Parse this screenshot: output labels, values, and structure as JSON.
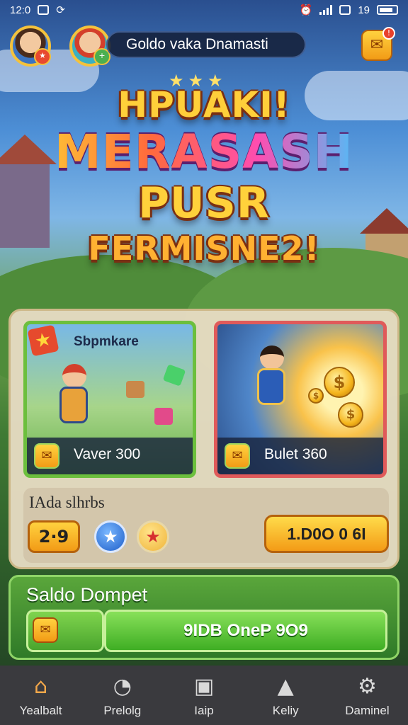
{
  "status_bar": {
    "time": "12:0",
    "battery": "19"
  },
  "header": {
    "player_name": "Goldo vaka Dnamasti"
  },
  "title": {
    "line1": "HPUAKI!",
    "line2": "MERASASH",
    "line3": "PUSR",
    "line4": "FERMISNE2!"
  },
  "cards": [
    {
      "label": "Sbpmkare",
      "value": "Vaver 300",
      "icon": "envelope-icon"
    },
    {
      "label": "",
      "value": "Bulet 360",
      "icon": "envelope-icon"
    }
  ],
  "sub_panel": {
    "title": "IAda slhrbs",
    "count": "2·9",
    "cta_label": "1.D0O 0 6I"
  },
  "wallet": {
    "title": "Saldo Dompet",
    "balance": "9IDB OneP 9O9"
  },
  "bottom_nav": [
    {
      "label": "Yealbalt",
      "icon": "home-icon",
      "active": true
    },
    {
      "label": "Prelolg",
      "icon": "clock-icon",
      "active": false
    },
    {
      "label": "Iaip",
      "icon": "card-icon",
      "active": false
    },
    {
      "label": "Keliy",
      "icon": "trophy-icon",
      "active": false
    },
    {
      "label": "Daminel",
      "icon": "gear-icon",
      "active": false
    }
  ],
  "colors": {
    "accent": "#f29b16",
    "wallet_green": "#3fae24",
    "nav_bg": "#3a3a3e"
  }
}
